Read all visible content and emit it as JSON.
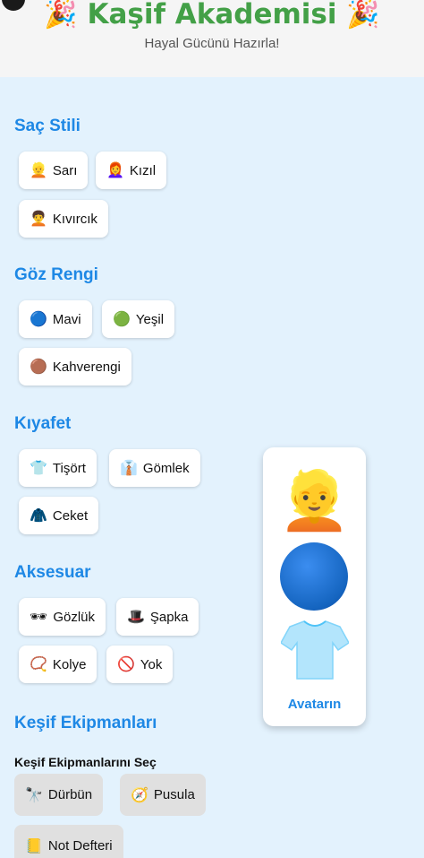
{
  "header": {
    "title": "Kaşif Akademisi",
    "title_emoji": "🎉",
    "subtitle": "Hayal Gücünü Hazırla!"
  },
  "sections": {
    "hair": {
      "title": "Saç Stili",
      "options": [
        {
          "icon": "👱",
          "label": "Sarı"
        },
        {
          "icon": "👩‍🦰",
          "label": "Kızıl"
        },
        {
          "icon": "🧑‍🦱",
          "label": "Kıvırcık"
        }
      ]
    },
    "eye": {
      "title": "Göz Rengi",
      "options": [
        {
          "icon": "🔵",
          "label": "Mavi"
        },
        {
          "icon": "🟢",
          "label": "Yeşil"
        },
        {
          "icon": "🟤",
          "label": "Kahverengi"
        }
      ]
    },
    "outfit": {
      "title": "Kıyafet",
      "options": [
        {
          "icon": "👕",
          "label": "Tişört"
        },
        {
          "icon": "👔",
          "label": "Gömlek"
        },
        {
          "icon": "🧥",
          "label": "Ceket"
        }
      ]
    },
    "accessory": {
      "title": "Aksesuar",
      "options": [
        {
          "icon": "🕶",
          "label": "Gözlük"
        },
        {
          "icon": "🎩",
          "label": "Şapka"
        },
        {
          "icon": "📿",
          "label": "Kolye"
        },
        {
          "icon": "🚫",
          "label": "Yok"
        }
      ]
    },
    "equipment": {
      "title": "Keşif Ekipmanları",
      "subheading": "Keşif Ekipmanlarını Seç",
      "options": [
        {
          "icon": "🔭",
          "label": "Dürbün"
        },
        {
          "icon": "🧭",
          "label": "Pusula"
        },
        {
          "icon": "📒",
          "label": "Not Defteri"
        }
      ]
    }
  },
  "avatar": {
    "caption": "Avatarın",
    "hair_icon": "👱",
    "eye_color": "#1565c0",
    "shirt_color": "#b3e5fc"
  },
  "colors": {
    "background": "#e3f2fd",
    "title_green": "#43a047",
    "section_blue": "#1e88e5"
  }
}
